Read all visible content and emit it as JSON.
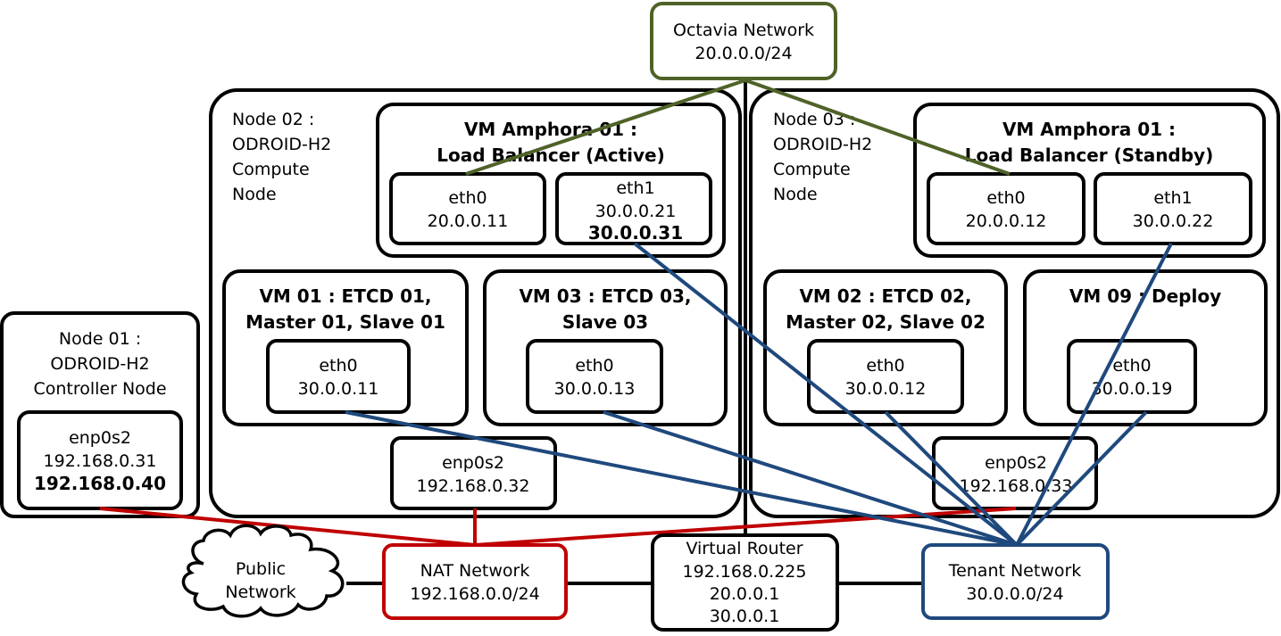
{
  "colors": {
    "octavia": "#4f6228",
    "nat": "#c00000",
    "tenant": "#1f497d",
    "black": "#000000"
  },
  "networks": {
    "octavia": {
      "name": "Octavia Network",
      "cidr": "20.0.0.0/24"
    },
    "nat": {
      "name": "NAT Network",
      "cidr": "192.168.0.0/24"
    },
    "tenant": {
      "name": "Tenant Network",
      "cidr": "30.0.0.0/24"
    },
    "public": {
      "line1": "Public",
      "line2": "Network"
    },
    "router": {
      "name": "Virtual Router",
      "ips": [
        "192.168.0.225",
        "20.0.0.1",
        "30.0.0.1"
      ]
    }
  },
  "node01": {
    "title": [
      "Node 01 :",
      "ODROID-H2",
      "Controller Node"
    ],
    "nic": {
      "name": "enp0s2",
      "ip": "192.168.0.31",
      "vip": "192.168.0.40"
    }
  },
  "node02": {
    "title": [
      "Node 02 :",
      "ODROID-H2",
      "Compute",
      "Node"
    ],
    "amphora": {
      "title": [
        "VM Amphora 01 :",
        "Load Balancer (Active)"
      ],
      "eth0": {
        "name": "eth0",
        "ip": "20.0.0.11"
      },
      "eth1": {
        "name": "eth1",
        "ip": "30.0.0.21",
        "vip": "30.0.0.31"
      }
    },
    "vm01": {
      "title": [
        "VM 01 : ETCD 01,",
        "Master 01, Slave 01"
      ],
      "eth0": {
        "name": "eth0",
        "ip": "30.0.0.11"
      }
    },
    "vm03": {
      "title": [
        "VM 03 : ETCD 03,",
        "Slave 03"
      ],
      "eth0": {
        "name": "eth0",
        "ip": "30.0.0.13"
      }
    },
    "nic": {
      "name": "enp0s2",
      "ip": "192.168.0.32"
    }
  },
  "node03": {
    "title": [
      "Node 03 :",
      "ODROID-H2",
      "Compute",
      "Node"
    ],
    "amphora": {
      "title": [
        "VM Amphora 01 :",
        "Load Balancer (Standby)"
      ],
      "eth0": {
        "name": "eth0",
        "ip": "20.0.0.12"
      },
      "eth1": {
        "name": "eth1",
        "ip": "30.0.0.22"
      }
    },
    "vm02": {
      "title": [
        "VM 02 : ETCD 02,",
        "Master 02, Slave 02"
      ],
      "eth0": {
        "name": "eth0",
        "ip": "30.0.0.12"
      }
    },
    "vm09": {
      "title": [
        "VM 09 : Deploy"
      ],
      "eth0": {
        "name": "eth0",
        "ip": "30.0.0.19"
      }
    },
    "nic": {
      "name": "enp0s2",
      "ip": "192.168.0.33"
    }
  }
}
